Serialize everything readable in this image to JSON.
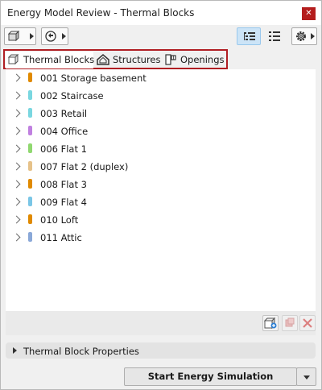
{
  "window": {
    "title": "Energy Model Review - Thermal Blocks",
    "close_glyph": "✕",
    "close_icon": "close-icon"
  },
  "toolbar": {
    "buttons": [
      {
        "icon": "model-icon"
      },
      {
        "icon": "refresh-icon"
      }
    ],
    "view_buttons": [
      {
        "icon": "tree-view-icon",
        "active": true
      },
      {
        "icon": "list-view-icon",
        "active": false
      },
      {
        "icon": "gear-icon",
        "active": false
      }
    ]
  },
  "tabs": [
    {
      "label": "Thermal Blocks",
      "icon": "thermal-blocks-icon",
      "active": true
    },
    {
      "label": "Structures",
      "icon": "structures-icon",
      "active": false
    },
    {
      "label": "Openings",
      "icon": "openings-icon",
      "active": false
    }
  ],
  "thermal_blocks": [
    {
      "label": "001 Storage basement",
      "color": "#e08a00"
    },
    {
      "label": "002 Staircase",
      "color": "#7ad7e0"
    },
    {
      "label": "003 Retail",
      "color": "#7ad7e0"
    },
    {
      "label": "004 Office",
      "color": "#c080e0"
    },
    {
      "label": "006 Flat 1",
      "color": "#90d870"
    },
    {
      "label": "007 Flat 2 (duplex)",
      "color": "#e6c28a"
    },
    {
      "label": "008 Flat 3",
      "color": "#e08a00"
    },
    {
      "label": "009 Flat 4",
      "color": "#7ac6e6"
    },
    {
      "label": "010 Loft",
      "color": "#e08a00"
    },
    {
      "label": "011 Attic",
      "color": "#8aa8d8"
    }
  ],
  "list_actions": [
    {
      "icon": "add-block-icon"
    },
    {
      "icon": "duplicate-block-icon"
    },
    {
      "icon": "delete-block-icon"
    }
  ],
  "properties_panel": {
    "label": "Thermal Block Properties"
  },
  "footer": {
    "simulate_label": "Start Energy Simulation"
  }
}
